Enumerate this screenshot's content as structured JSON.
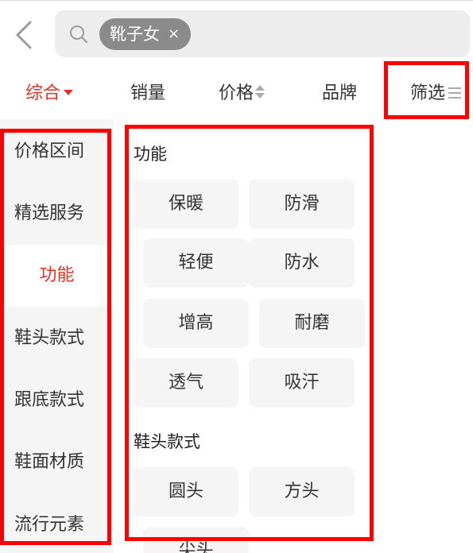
{
  "search": {
    "query_chip": "靴子女",
    "chip_close": "×"
  },
  "sort_tabs": [
    {
      "label": "综合",
      "active": true,
      "indicator": "triangle-down"
    },
    {
      "label": "销量",
      "active": false
    },
    {
      "label": "价格",
      "active": false,
      "indicator": "sort-up-down"
    },
    {
      "label": "品牌",
      "active": false
    },
    {
      "label": "筛选",
      "active": false,
      "indicator": "filter-lines"
    }
  ],
  "sidebar": {
    "items": [
      "价格区间",
      "精选服务",
      "功能",
      "鞋头款式",
      "跟底款式",
      "鞋面材质",
      "流行元素"
    ],
    "active_index": 2
  },
  "panel": {
    "sections": [
      {
        "title": "功能",
        "options": [
          "保暖",
          "防滑",
          "轻便",
          "防水",
          "增高",
          "耐磨",
          "透气",
          "吸汗"
        ]
      },
      {
        "title": "鞋头款式",
        "options": [
          "圆头",
          "方头",
          "尖头"
        ]
      }
    ]
  },
  "colors": {
    "accent": "#e0342a",
    "annotation": "#ff0000",
    "option_bg": "#f5f5f5",
    "sidebar_bg": "#f5f5f5",
    "chip_bg": "#8a8a8a"
  }
}
